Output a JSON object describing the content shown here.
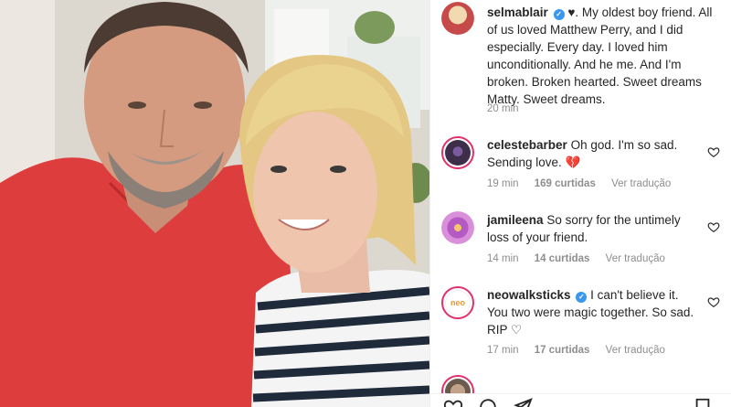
{
  "post": {
    "photo_description": "",
    "caption": {
      "username": "selmablair",
      "text": "♥. My oldest boy friend. All of us loved Matthew Perry, and I did especially. Every day. I loved him unconditionally. And he me. And I'm broken. Broken hearted. Sweet dreams Matty. Sweet dreams.",
      "time": "20 min"
    }
  },
  "comments": [
    {
      "username": "celestebarber",
      "text": "Oh god. I'm so sad. Sending love. 💔",
      "time": "19 min",
      "likes": "169 curtidas",
      "translate": "Ver tradução"
    },
    {
      "username": "jamileena",
      "text": "So sorry for the untimely loss of your friend.",
      "time": "14 min",
      "likes": "14 curtidas",
      "translate": "Ver tradução"
    },
    {
      "username": "neowalksticks",
      "text": "I can't believe it. You two were magic together. So sad. RIP ♡",
      "time": "17 min",
      "likes": "17 curtidas",
      "translate": "Ver tradução"
    }
  ],
  "colors": {
    "verified": "#3897f0",
    "muted": "#8e8e8e",
    "text": "#262626",
    "story_ring": "#e1306c"
  },
  "icons": [
    "verified-badge-icon",
    "heart-outline-icon",
    "like-icon",
    "comment-icon",
    "share-icon",
    "save-icon"
  ]
}
